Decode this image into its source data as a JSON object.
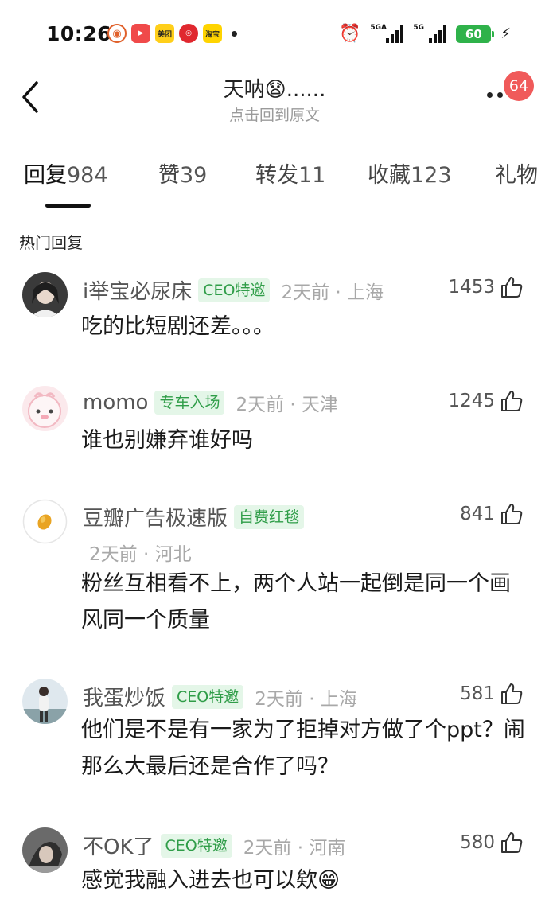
{
  "status_bar": {
    "time": "10:26",
    "notif_apps": [
      "weibo-icon",
      "video-icon",
      "meituan-icon",
      "bank-icon",
      "taobao-icon"
    ],
    "meituan_label": "美团",
    "taobao_label": "淘宝",
    "signal1_label": "5GA",
    "signal2_label": "5G",
    "battery": "60"
  },
  "header": {
    "title": "天呐😧......",
    "subtitle": "点击回到原文",
    "badge": "64"
  },
  "tabs": [
    {
      "label": "回复",
      "count": "984"
    },
    {
      "label": "赞",
      "count": "39"
    },
    {
      "label": "转发",
      "count": "11"
    },
    {
      "label": "收藏",
      "count": "123"
    },
    {
      "label": "礼物",
      "count": ""
    }
  ],
  "section_title": "热门回复",
  "comments": [
    {
      "name": "i举宝必尿床",
      "tag": "CEO特邀",
      "meta": "2天前 · 上海",
      "likes": "1453",
      "text": "吃的比短剧还差。。。"
    },
    {
      "name": "momo",
      "tag": "专车入场",
      "meta": "2天前 · 天津",
      "likes": "1245",
      "text": "谁也别嫌弃谁好吗"
    },
    {
      "name": "豆瓣广告极速版",
      "tag": "自费红毯",
      "meta": "2天前 · 河北",
      "likes": "841",
      "text": "粉丝互相看不上，两个人站一起倒是同一个画风同一个质量"
    },
    {
      "name": "我蛋炒饭",
      "tag": "CEO特邀",
      "meta": "2天前 · 上海",
      "likes": "581",
      "text": "他们是不是有一家为了拒掉对方做了个ppt？闹那么大最后还是合作了吗？"
    },
    {
      "name": "不OK了",
      "tag": "CEO特邀",
      "meta": "2天前 · 河南",
      "likes": "580",
      "text": "感觉我融入进去也可以欸😁"
    }
  ],
  "colors": {
    "tag_bg": "#e4f6e8",
    "tag_text": "#2f9d48",
    "badge": "#f05a5a",
    "battery": "#2fb24a"
  }
}
